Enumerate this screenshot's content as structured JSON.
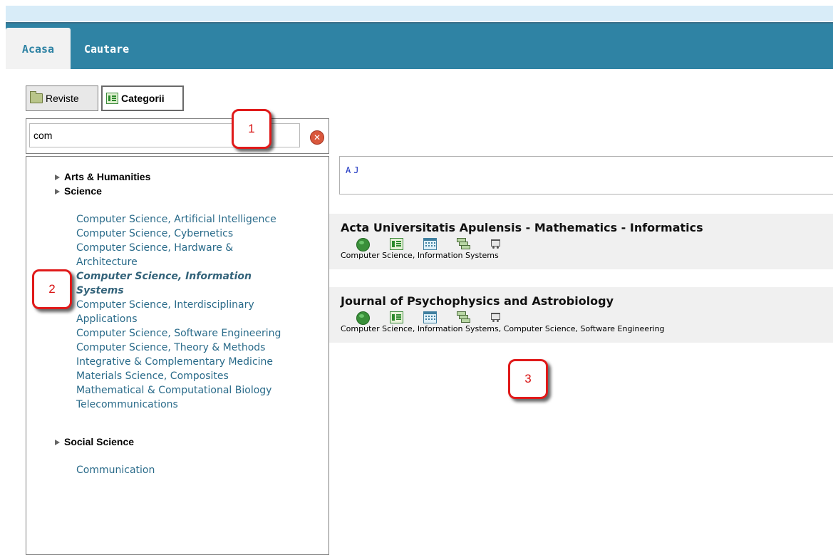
{
  "header": {
    "tabs": [
      {
        "label": "Acasa",
        "active": true
      },
      {
        "label": "Cautare",
        "active": false
      }
    ]
  },
  "toolbar": {
    "reviste_label": "Reviste",
    "categorii_label": "Categorii"
  },
  "search": {
    "value": "com"
  },
  "groups": [
    {
      "label": "Arts & Humanities"
    },
    {
      "label": "Science"
    },
    {
      "label": "Social Science"
    }
  ],
  "science_items": [
    "Computer Science, Artificial Intelligence",
    "Computer Science, Cybernetics",
    "Computer Science, Hardware &",
    "Architecture",
    "Computer Science, Information",
    "Systems",
    "Computer Science, Interdisciplinary",
    "Applications",
    "Computer Science, Software Engineering",
    "Computer Science, Theory & Methods",
    "Integrative & Complementary Medicine",
    "Materials Science, Composites",
    "Mathematical & Computational Biology",
    "Telecommunications"
  ],
  "social_items": [
    "Communication"
  ],
  "letters": [
    "A",
    "J"
  ],
  "results": [
    {
      "title": "Acta Universitatis Apulensis - Mathematics - Informatics",
      "categories": "Computer Science, Information Systems"
    },
    {
      "title": "Journal of Psychophysics and Astrobiology",
      "categories": "Computer Science, Information Systems, Computer Science, Software Engineering"
    }
  ],
  "callouts": [
    "1",
    "2",
    "3"
  ],
  "colors": {
    "nav": "#2f83a4",
    "link": "#2a6b8a",
    "callout": "#e01a1a"
  }
}
